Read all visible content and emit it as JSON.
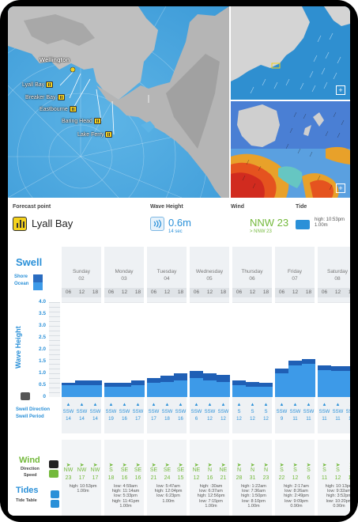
{
  "map": {
    "places": [
      {
        "name": "Wellington",
        "type": "city"
      },
      {
        "name": "Lyall Bay",
        "type": "spot"
      },
      {
        "name": "Breaker Bay",
        "type": "spot"
      },
      {
        "name": "Eastbourne",
        "type": "spot"
      },
      {
        "name": "Baring Head",
        "type": "spot"
      },
      {
        "name": "Lake Ferry",
        "type": "spot"
      }
    ],
    "expand_symbol": "+"
  },
  "info": {
    "forecast_point_label": "Forecast point",
    "spot_name": "Lyall Bay",
    "wave_height_label": "Wave Height",
    "wave_value": "0.6m",
    "wave_period": "14 sec",
    "wind_label": "Wind",
    "wind_value": "NNW 23",
    "wind_sub": "> NNW 23",
    "tide_label": "Tide",
    "tide_line1": "high: 10:53pm",
    "tide_line2": "1.00m"
  },
  "swell": {
    "title": "Swell",
    "shore_label": "Shore",
    "ocean_label": "Ocean",
    "wave_height_axis_label": "Wave Height",
    "y_ticks": [
      "4.0",
      "3.5",
      "3.0",
      "2.5",
      "2.0",
      "1.5",
      "1.0",
      "0.5",
      "0"
    ],
    "swell_direction_label": "Swell Direction",
    "swell_period_label": "Swell Period",
    "hours": [
      "06",
      "12",
      "18"
    ],
    "days": [
      {
        "name": "Sunday",
        "num": "02",
        "dirs": [
          "SSW",
          "SSW",
          "SSW"
        ],
        "periods": [
          "14",
          "14",
          "14"
        ],
        "ocean": [
          0.6,
          0.7,
          0.7
        ],
        "shore": [
          0.5,
          0.5,
          0.5
        ]
      },
      {
        "name": "Monday",
        "num": "03",
        "dirs": [
          "SSW",
          "SSW",
          "SSW"
        ],
        "periods": [
          "19",
          "16",
          "17"
        ],
        "ocean": [
          0.6,
          0.6,
          0.7
        ],
        "shore": [
          0.45,
          0.45,
          0.5
        ]
      },
      {
        "name": "Tuesday",
        "num": "04",
        "dirs": [
          "SSW",
          "SSW",
          "SSW"
        ],
        "periods": [
          "17",
          "18",
          "16"
        ],
        "ocean": [
          0.8,
          0.9,
          1.0
        ],
        "shore": [
          0.6,
          0.65,
          0.7
        ]
      },
      {
        "name": "Wednesday",
        "num": "05",
        "dirs": [
          "SSW",
          "SSW",
          "SSW"
        ],
        "periods": [
          "6",
          "12",
          "12"
        ],
        "ocean": [
          1.1,
          1.0,
          0.95
        ],
        "shore": [
          0.8,
          0.7,
          0.65
        ]
      },
      {
        "name": "Thursday",
        "num": "06",
        "dirs": [
          "S",
          "S",
          "S"
        ],
        "periods": [
          "12",
          "12",
          "12"
        ],
        "ocean": [
          0.7,
          0.65,
          0.6
        ],
        "shore": [
          0.5,
          0.45,
          0.45
        ]
      },
      {
        "name": "Friday",
        "num": "07",
        "dirs": [
          "SSW",
          "SSW",
          "SSW"
        ],
        "periods": [
          "9",
          "11",
          "11"
        ],
        "ocean": [
          1.2,
          1.55,
          1.6
        ],
        "shore": [
          1.0,
          1.35,
          1.4
        ]
      },
      {
        "name": "Saturday",
        "num": "08",
        "dirs": [
          "SSW",
          "SSW",
          "SSW"
        ],
        "periods": [
          "11",
          "11",
          "13"
        ],
        "ocean": [
          1.35,
          1.3,
          1.3
        ],
        "shore": [
          1.15,
          1.1,
          1.1
        ]
      }
    ]
  },
  "wind": {
    "title": "Wind",
    "direction_label": "Direction",
    "speed_label": "Speed",
    "days": [
      {
        "dirs": [
          "NW",
          "NW",
          "NW"
        ],
        "speeds": [
          "23",
          "17",
          "17"
        ]
      },
      {
        "dirs": [
          "S",
          "SE",
          "SE"
        ],
        "speeds": [
          "18",
          "16",
          "16"
        ]
      },
      {
        "dirs": [
          "SE",
          "SE",
          "SE"
        ],
        "speeds": [
          "21",
          "24",
          "15"
        ]
      },
      {
        "dirs": [
          "NE",
          "N",
          "NE"
        ],
        "speeds": [
          "12",
          "16",
          "21"
        ]
      },
      {
        "dirs": [
          "N",
          "N",
          "N"
        ],
        "speeds": [
          "28",
          "31",
          "23"
        ]
      },
      {
        "dirs": [
          "S",
          "S",
          "S"
        ],
        "speeds": [
          "22",
          "12",
          "6"
        ]
      },
      {
        "dirs": [
          "S",
          "S",
          "S"
        ],
        "speeds": [
          "11",
          "12",
          "13"
        ]
      }
    ]
  },
  "tides": {
    "title": "Tides",
    "table_label": "Tide Table",
    "days": [
      "high: 10:53pm\n1.00m",
      "low: 4:59am\nhigh: 11:14am\nlow: 5:33pm\nhigh: 11:41pm\n1.00m",
      "low: 5:47am\nhigh: 12:04pm\nlow: 6:23pm\n1.00m",
      "high: :30am\nlow: 6:37am\nhigh: 12:56pm\nlow: 7:15pm\n1.00m",
      "high: 1:22am\nlow: 7:36am\nhigh: 1:50pm\nlow: 8:10pm\n1.00m",
      "high: 2:17am\nlow: 8:26am\nhigh: 2:49pm\nlow: 9:09pm\n0.90m",
      "high: 10:13pm\nlow: 9:32am\nhigh: 3:52pm\nlow: 10:20pm\n0.90m"
    ]
  }
}
